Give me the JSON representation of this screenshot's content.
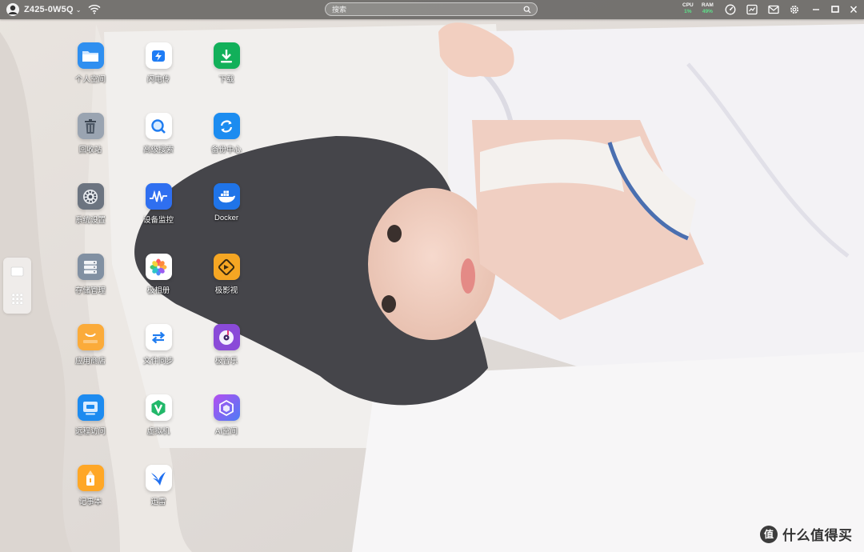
{
  "topbar": {
    "device_name": "Z425-0W5Q",
    "search_placeholder": "搜索",
    "cpu": {
      "label": "CPU",
      "value": "1%"
    },
    "ram": {
      "label": "RAM",
      "value": "49%"
    }
  },
  "desktop": {
    "apps": [
      {
        "label": "个人空间",
        "icon": "folder-icon",
        "color": "#2f8ff0"
      },
      {
        "label": "闪电传",
        "icon": "lightning-transfer-icon",
        "color": "#ffffff"
      },
      {
        "label": "下载",
        "icon": "download-icon",
        "color": "#12b05a"
      },
      {
        "label": "回收站",
        "icon": "trash-icon",
        "color": "#9aa4b1"
      },
      {
        "label": "高级搜索",
        "icon": "magnifier-icon",
        "color": "#ffffff"
      },
      {
        "label": "备份中心",
        "icon": "backup-sync-icon",
        "color": "#1c8cf0"
      },
      {
        "label": "系统设置",
        "icon": "gear-icon",
        "color": "#6c7480"
      },
      {
        "label": "设备监控",
        "icon": "pulse-monitor-icon",
        "color": "#2f6ff0"
      },
      {
        "label": "Docker",
        "icon": "docker-whale-icon",
        "color": "#1f74e8"
      },
      {
        "label": "存储管理",
        "icon": "storage-drive-icon",
        "color": "#8190a2"
      },
      {
        "label": "极相册",
        "icon": "photo-flower-icon",
        "color": "#ffffff"
      },
      {
        "label": "极影视",
        "icon": "film-icon",
        "color": "#f5a623"
      },
      {
        "label": "应用商店",
        "icon": "store-bag-icon",
        "color": "#fbab3a"
      },
      {
        "label": "文件同步",
        "icon": "file-sync-arrows-icon",
        "color": "#ffffff"
      },
      {
        "label": "极音乐",
        "icon": "music-disc-icon",
        "color": "#8a4ad8"
      },
      {
        "label": "远程访问",
        "icon": "remote-window-icon",
        "color": "#1d8bf0"
      },
      {
        "label": "虚拟机",
        "icon": "virtual-machine-v-icon",
        "color": "#ffffff"
      },
      {
        "label": "AI空间",
        "icon": "ai-cube-icon",
        "color": "#7e5cf0"
      },
      {
        "label": "记事本",
        "icon": "notepad-pencil-icon",
        "color": "#ffa726"
      },
      {
        "label": "迅雷",
        "icon": "xunlei-bird-icon",
        "color": "#ffffff"
      }
    ]
  },
  "watermark": {
    "mark_glyph": "值",
    "text": "什么值得买"
  }
}
